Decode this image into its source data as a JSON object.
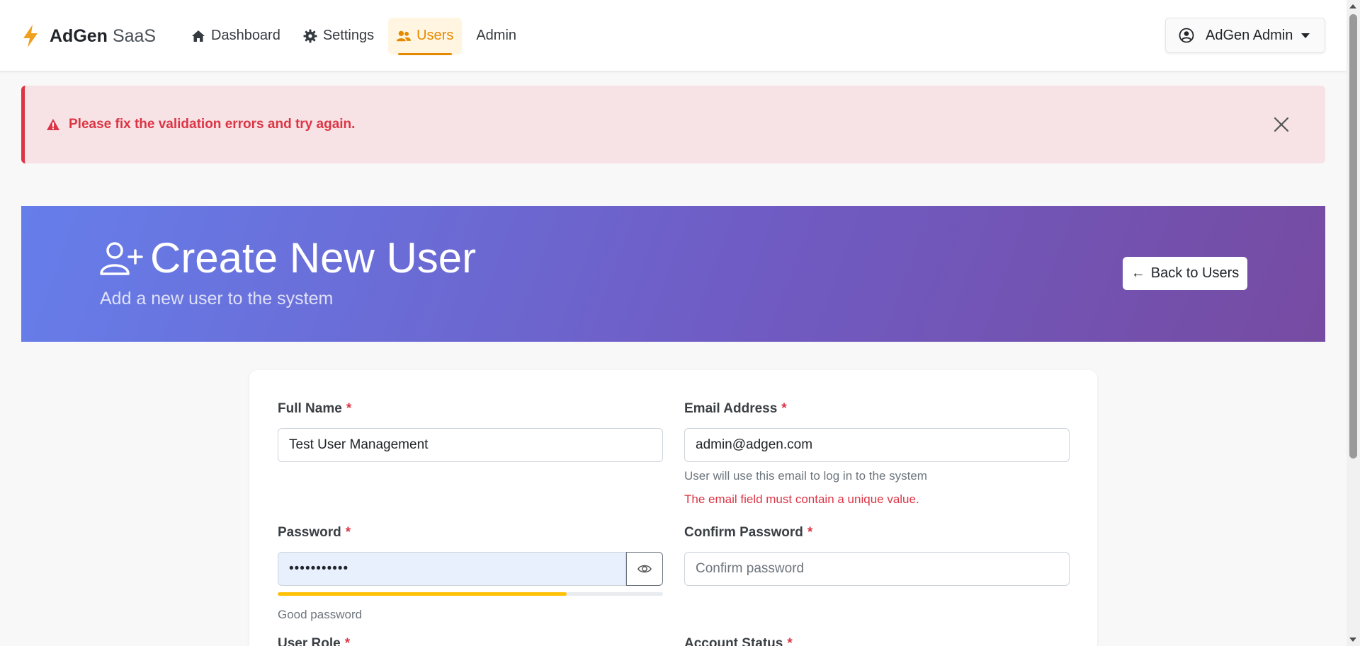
{
  "navbar": {
    "brand_strong": "AdGen",
    "brand_light": "SaaS",
    "brand_icon": "bolt-icon",
    "links": [
      {
        "label": "Dashboard",
        "icon": "home-icon"
      },
      {
        "label": "Settings",
        "icon": "gear-icon"
      },
      {
        "label": "Users",
        "icon": "users-icon",
        "active": true
      },
      {
        "label": "Admin"
      }
    ],
    "user_menu": {
      "label": "AdGen Admin",
      "icon": "user-circle-icon"
    }
  },
  "alert": {
    "message": "Please fix the validation errors and try again.",
    "icon": "warning-triangle-icon"
  },
  "hero": {
    "title": "Create New User",
    "subtitle": "Add a new user to the system",
    "icon": "user-plus-icon",
    "back_button": "Back to Users",
    "back_arrow": "←"
  },
  "form": {
    "full_name": {
      "label": "Full Name",
      "value": "Test User Management",
      "required": "*"
    },
    "email": {
      "label": "Email Address",
      "value": "admin@adgen.com",
      "required": "*",
      "help": "User will use this email to log in to the system",
      "error": "The email field must contain a unique value."
    },
    "password": {
      "label": "Password",
      "value": "•••••••••••",
      "required": "*",
      "strength_label": "Good password",
      "strength": 0.75
    },
    "confirm_password": {
      "label": "Confirm Password",
      "placeholder": "Confirm password",
      "required": "*"
    },
    "user_role": {
      "label": "User Role",
      "required": "*"
    },
    "account_status": {
      "label": "Account Status",
      "required": "*"
    }
  },
  "colors": {
    "accent": "#e58a00",
    "danger": "#dc3545",
    "strength": "#ffc107",
    "hero_gradient_start": "#667eea",
    "hero_gradient_end": "#764ba2"
  }
}
